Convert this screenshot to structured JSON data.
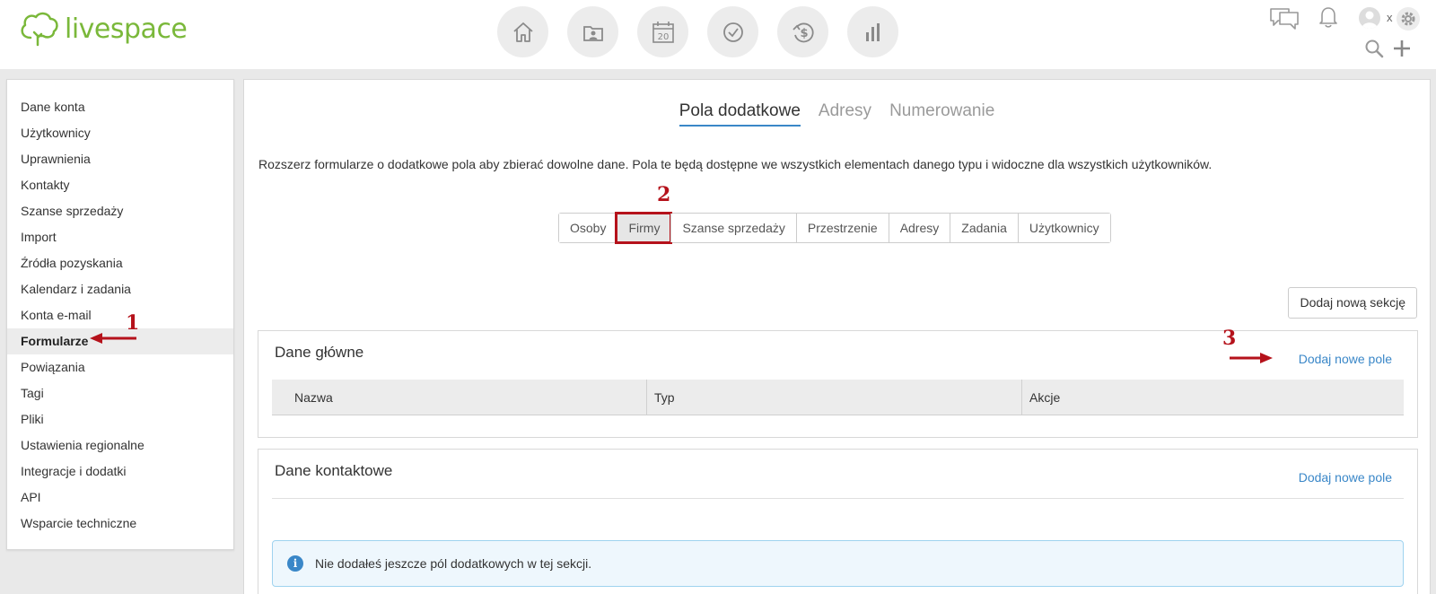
{
  "brand": {
    "logo_text": "livespace",
    "accent_color": "#7ab83a"
  },
  "nav": {
    "icons": [
      "home-icon",
      "contacts-icon",
      "calendar-icon",
      "tasks-icon",
      "deals-icon",
      "reports-icon"
    ],
    "calendar_day": "20"
  },
  "user": {
    "name": "x"
  },
  "sidebar": {
    "items": [
      {
        "label": "Dane konta"
      },
      {
        "label": "Użytkownicy"
      },
      {
        "label": "Uprawnienia"
      },
      {
        "label": "Kontakty"
      },
      {
        "label": "Szanse sprzedaży"
      },
      {
        "label": "Import"
      },
      {
        "label": "Źródła pozyskania"
      },
      {
        "label": "Kalendarz i zadania"
      },
      {
        "label": "Konta e-mail"
      },
      {
        "label": "Formularze",
        "active": true
      },
      {
        "label": "Powiązania"
      },
      {
        "label": "Tagi"
      },
      {
        "label": "Pliki"
      },
      {
        "label": "Ustawienia regionalne"
      },
      {
        "label": "Integracje i dodatki"
      },
      {
        "label": "API"
      },
      {
        "label": "Wsparcie techniczne"
      }
    ]
  },
  "main": {
    "tabs": [
      {
        "label": "Pola dodatkowe",
        "active": true
      },
      {
        "label": "Adresy"
      },
      {
        "label": "Numerowanie"
      }
    ],
    "description": "Rozszerz formularze o dodatkowe pola aby zbierać dowolne dane. Pola te będą dostępne we wszystkich elementach danego typu i widoczne dla wszystkich użytkowników.",
    "segments": [
      {
        "label": "Osoby"
      },
      {
        "label": "Firmy",
        "active": true
      },
      {
        "label": "Szanse sprzedaży"
      },
      {
        "label": "Przestrzenie"
      },
      {
        "label": "Adresy"
      },
      {
        "label": "Zadania"
      },
      {
        "label": "Użytkownicy"
      }
    ],
    "add_section_label": "Dodaj nową sekcję",
    "sections": [
      {
        "title": "Dane główne",
        "add_field_label": "Dodaj nowe pole",
        "columns": [
          "Nazwa",
          "Typ",
          "Akcje"
        ]
      },
      {
        "title": "Dane kontaktowe",
        "add_field_label": "Dodaj nowe pole",
        "info": "Nie dodałeś jeszcze pól dodatkowych w tej sekcji."
      }
    ]
  },
  "annotations": [
    "1",
    "2",
    "3"
  ],
  "colors": {
    "annotation": "#b5121b",
    "link": "#3a87c8"
  }
}
